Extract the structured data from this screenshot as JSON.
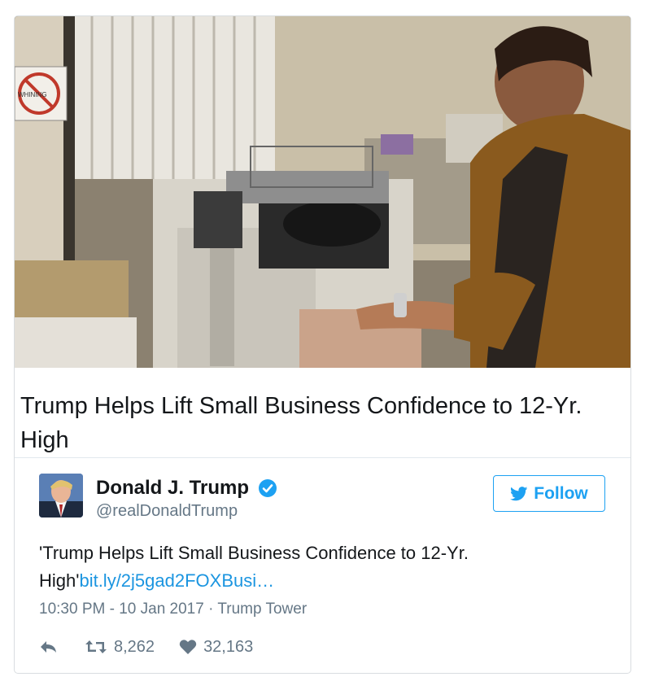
{
  "photo": {
    "sign_text": "WHINING"
  },
  "card": {
    "headline": "Trump Helps Lift Small Business Confidence to 12-Yr. High"
  },
  "author": {
    "display_name": "Donald J. Trump",
    "handle": "@realDonaldTrump",
    "verified": true
  },
  "follow_button": {
    "label": "Follow"
  },
  "tweet": {
    "text": "'Trump Helps Lift Small Business Confidence to 12-Yr. High'",
    "link": "bit.ly/2j5gad2FOXBusi…",
    "timestamp": "10:30 PM - 10 Jan 2017",
    "separator": "·",
    "location": "Trump Tower"
  },
  "actions": {
    "reply_icon": "reply-icon",
    "retweet_icon": "retweet-icon",
    "like_icon": "heart-icon",
    "retweets": "8,262",
    "likes": "32,163"
  },
  "colors": {
    "accent": "#1da1f2",
    "link": "#1b95e0",
    "text": "#14171a",
    "muted": "#657786",
    "border": "#e1e8ed"
  }
}
